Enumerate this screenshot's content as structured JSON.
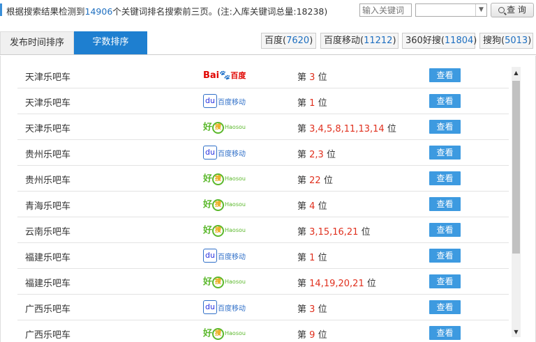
{
  "summary": {
    "prefix": "根据搜索结果检测到",
    "count": "14906",
    "suffix": "个关键词排名搜索前三页。(注:入库关键词总量:18238)"
  },
  "search": {
    "placeholder": "输入关键词",
    "select_value": "",
    "button_label": "查 询"
  },
  "tabs": [
    {
      "label": "发布时间排序",
      "active": false
    },
    {
      "label": "字数排序",
      "active": true
    }
  ],
  "engines": [
    {
      "name": "百度",
      "count": "7620"
    },
    {
      "name": "百度移动",
      "count": "11212"
    },
    {
      "name": "360好搜",
      "count": "11804"
    },
    {
      "name": "搜狗",
      "count": "5013"
    }
  ],
  "rank_prefix": "第",
  "rank_suffix": "位",
  "view_label": "查看",
  "logos": {
    "baidu": {
      "bai": "Bai",
      "paw": "🐾",
      "du": "百度"
    },
    "mobile": {
      "icon": "du",
      "text": "百度移动"
    },
    "haosou": {
      "hao": "好",
      "sou": "搜",
      "latin": "Haosou"
    }
  },
  "rows": [
    {
      "keyword": "天津乐吧车",
      "engine": "baidu",
      "positions": "3"
    },
    {
      "keyword": "天津乐吧车",
      "engine": "mobile",
      "positions": "1"
    },
    {
      "keyword": "天津乐吧车",
      "engine": "haosou",
      "positions": "3,4,5,8,11,13,14"
    },
    {
      "keyword": "贵州乐吧车",
      "engine": "mobile",
      "positions": "2,3"
    },
    {
      "keyword": "贵州乐吧车",
      "engine": "haosou",
      "positions": "22"
    },
    {
      "keyword": "青海乐吧车",
      "engine": "haosou",
      "positions": "4"
    },
    {
      "keyword": "云南乐吧车",
      "engine": "haosou",
      "positions": "3,15,16,21"
    },
    {
      "keyword": "福建乐吧车",
      "engine": "mobile",
      "positions": "1"
    },
    {
      "keyword": "福建乐吧车",
      "engine": "haosou",
      "positions": "14,19,20,21"
    },
    {
      "keyword": "广西乐吧车",
      "engine": "mobile",
      "positions": "3"
    },
    {
      "keyword": "广西乐吧车",
      "engine": "haosou",
      "positions": "9"
    }
  ],
  "colors": {
    "accent": "#1e7fd0",
    "rank_number": "#e0301e",
    "view_button": "#3d9ae0"
  }
}
